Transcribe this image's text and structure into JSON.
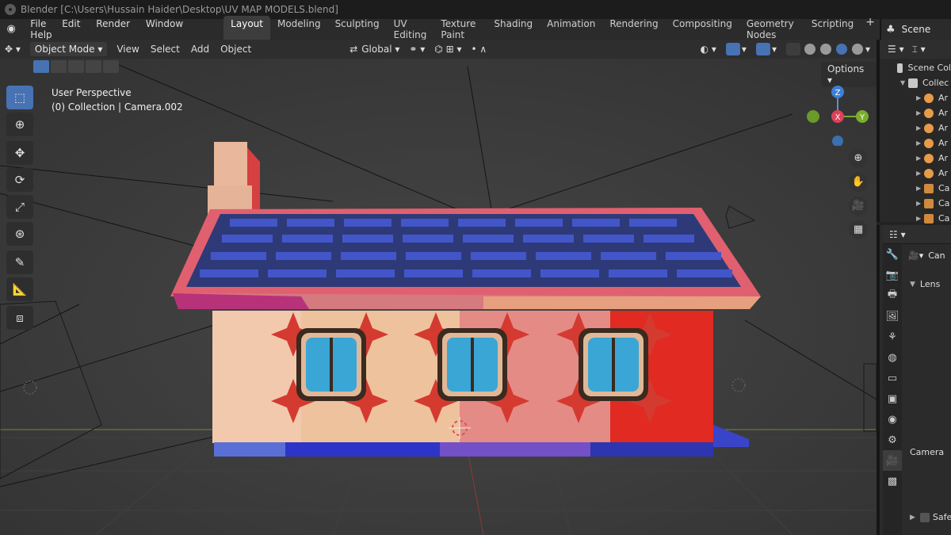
{
  "window": {
    "title": "Blender [C:\\Users\\Hussain Haider\\Desktop\\UV MAP MODELS.blend]"
  },
  "menu": [
    "File",
    "Edit",
    "Render",
    "Window",
    "Help"
  ],
  "workspaces": [
    "Layout",
    "Modeling",
    "Sculpting",
    "UV Editing",
    "Texture Paint",
    "Shading",
    "Animation",
    "Rendering",
    "Compositing",
    "Geometry Nodes",
    "Scripting"
  ],
  "workspace_add": "+",
  "scene": {
    "label": "Scene"
  },
  "header": {
    "mode": "Object Mode",
    "view": "View",
    "select": "Select",
    "add": "Add",
    "object": "Object",
    "transform": "Global"
  },
  "viewport": {
    "perspective": "User Perspective",
    "collection": "(0) Collection | Camera.002",
    "options": "Options"
  },
  "gizmo": {
    "z": "Z",
    "x": "X",
    "y": "Y"
  },
  "outliner": {
    "items": [
      {
        "label": "Scene Col",
        "type": "scene"
      },
      {
        "label": "Collec",
        "type": "coll"
      },
      {
        "label": "Ar",
        "type": "arm"
      },
      {
        "label": "Ar",
        "type": "arm"
      },
      {
        "label": "Ar",
        "type": "arm"
      },
      {
        "label": "Ar",
        "type": "arm"
      },
      {
        "label": "Ar",
        "type": "arm"
      },
      {
        "label": "Ar",
        "type": "arm"
      },
      {
        "label": "Ca",
        "type": "cam"
      },
      {
        "label": "Ca",
        "type": "cam"
      },
      {
        "label": "Ca",
        "type": "cam"
      }
    ]
  },
  "properties": {
    "object_field": "Can",
    "lens": "Lens",
    "camera": "Camera",
    "safe": "Safe"
  },
  "colors": {
    "accent": "#4772b3",
    "active_tab": "#7ad9b8"
  }
}
